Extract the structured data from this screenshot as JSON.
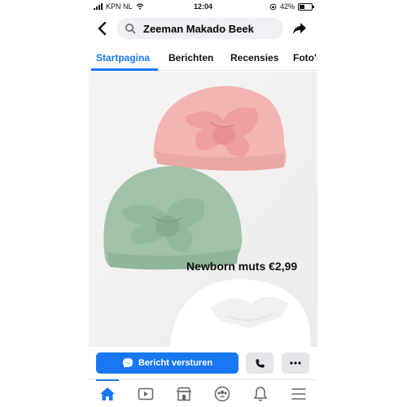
{
  "status_bar": {
    "carrier": "KPN NL",
    "time": "12:04",
    "battery": "42%"
  },
  "header": {
    "page_name": "Zeeman Makado Beek"
  },
  "tabs": [
    {
      "label": "Startpagina",
      "active": true
    },
    {
      "label": "Berichten",
      "active": false
    },
    {
      "label": "Recensies",
      "active": false
    },
    {
      "label": "Foto's",
      "active": false
    }
  ],
  "post": {
    "caption": "Newborn muts €2,99"
  },
  "actions": {
    "message_label": "Bericht versturen"
  },
  "bottom_nav": {
    "items": [
      "home-icon",
      "video-icon",
      "marketplace-icon",
      "groups-icon",
      "bell-icon",
      "menu-icon"
    ]
  },
  "colors": {
    "accent": "#1877f2",
    "hat_pink": "#f2b5b3",
    "hat_green": "#9fc2a8",
    "hat_white": "#ffffff"
  }
}
